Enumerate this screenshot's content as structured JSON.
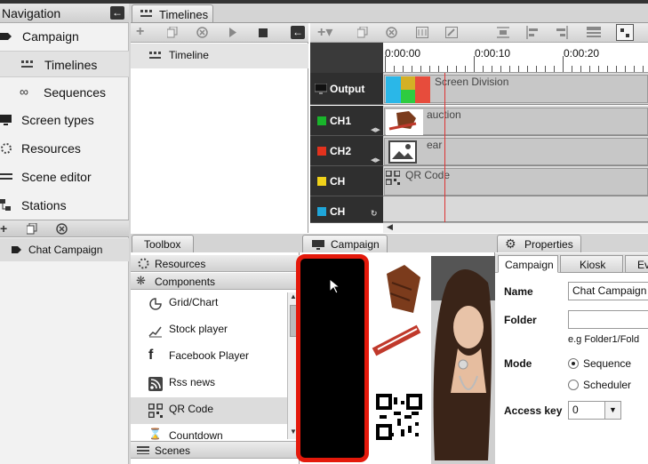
{
  "navigation": {
    "title": "Navigation",
    "items": [
      {
        "label": "Campaign"
      },
      {
        "label": "Timelines"
      },
      {
        "label": "Sequences"
      },
      {
        "label": "Screen types"
      },
      {
        "label": "Resources"
      },
      {
        "label": "Scene editor"
      },
      {
        "label": "Stations"
      }
    ],
    "campaign_list": [
      "Chat Campaign"
    ]
  },
  "timelines": {
    "tab_label": "Timelines",
    "list": [
      "Timeline"
    ],
    "ruler_labels": [
      "0:00:00",
      "0:00:10",
      "0:00:20"
    ],
    "tracks": [
      {
        "label": "Output",
        "clip": "Screen Division"
      },
      {
        "label": "CH1",
        "clip": "auction"
      },
      {
        "label": "CH2",
        "clip": "ear"
      },
      {
        "label": "CH",
        "clip": "QR Code"
      },
      {
        "label": "CH",
        "clip": ""
      }
    ]
  },
  "toolbox": {
    "tab_label": "Toolbox",
    "sections": {
      "resources": "Resources",
      "components": "Components",
      "scenes": "Scenes"
    },
    "components": [
      "Grid/Chart",
      "Stock player",
      "Facebook Player",
      "Rss news",
      "QR Code",
      "Countdown"
    ]
  },
  "campaign_tab": {
    "label": "Campaign"
  },
  "properties": {
    "tab_label": "Properties",
    "tabs": [
      "Campaign",
      "Kiosk",
      "Ev"
    ],
    "name_label": "Name",
    "name_value": "Chat Campaign",
    "folder_label": "Folder",
    "folder_value": "",
    "folder_hint": "e.g  Folder1/Fold",
    "mode_label": "Mode",
    "mode_options": [
      "Sequence",
      "Scheduler"
    ],
    "access_key_label": "Access key",
    "access_key_value": "0"
  },
  "colors": {
    "ch1": "#19b52b",
    "ch2": "#e3321d",
    "ch3": "#f0d21a",
    "ch4": "#1fa6d9",
    "frame": "#e4190b",
    "playhead": "#d33333"
  }
}
